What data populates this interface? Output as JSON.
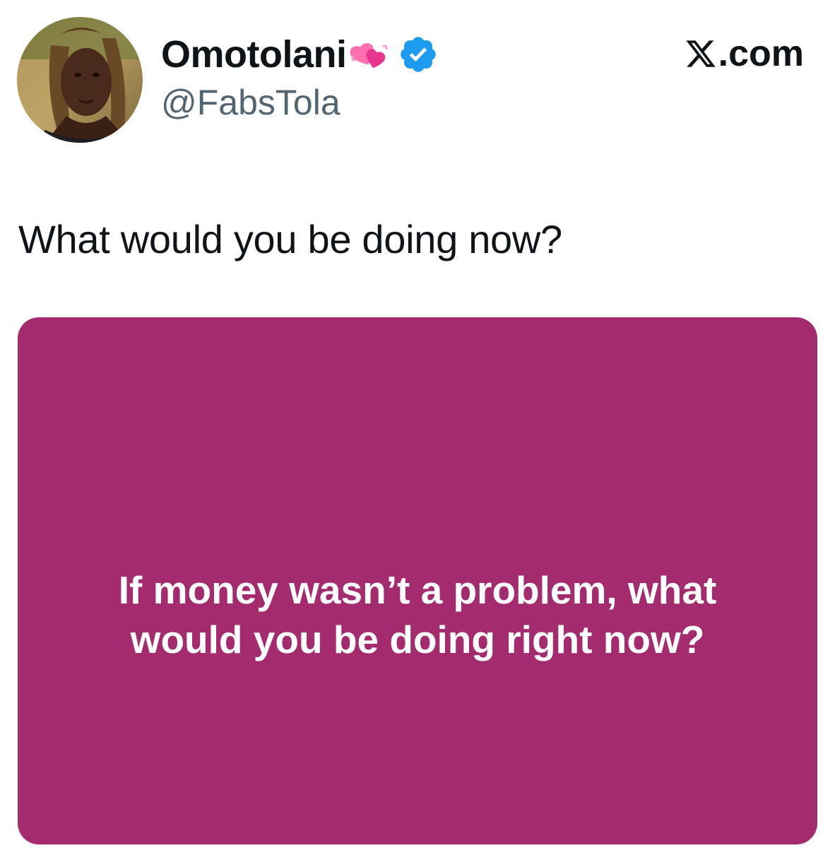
{
  "author": {
    "display_name": "Omotolani",
    "handle": "@FabsTola",
    "verified": true,
    "name_emoji": "heart-emoji"
  },
  "brand": {
    "label": ".com",
    "icon": "x-logo-icon"
  },
  "tweet": {
    "text": "What would you be doing now?"
  },
  "media": {
    "background_color": "#a52b6f",
    "text": "If money wasn’t a problem, what would you be doing right now?"
  },
  "colors": {
    "verified": "#1d9bf0",
    "handle": "#536471",
    "text": "#0f1419"
  }
}
